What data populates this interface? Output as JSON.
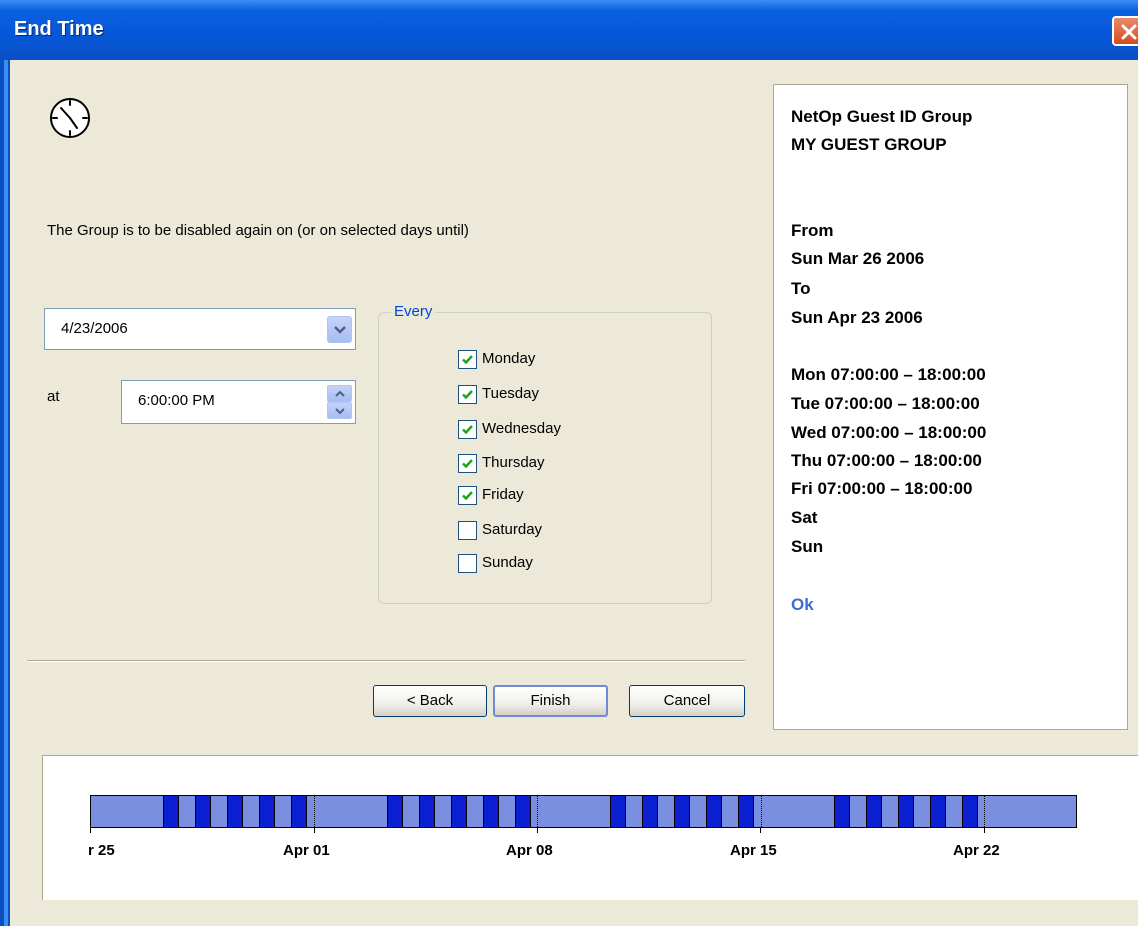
{
  "window": {
    "title": "End Time"
  },
  "description": "The Group is to be disabled again on (or on selected days until)",
  "end_date": {
    "value": "4/23/2006"
  },
  "end_time": {
    "label": "at",
    "value": "6:00:00 PM"
  },
  "every_group": {
    "legend": "Every",
    "days": [
      {
        "label": "Monday",
        "checked": true
      },
      {
        "label": "Tuesday",
        "checked": true
      },
      {
        "label": "Wednesday",
        "checked": true
      },
      {
        "label": "Thursday",
        "checked": true
      },
      {
        "label": "Friday",
        "checked": true
      },
      {
        "label": "Saturday",
        "checked": false
      },
      {
        "label": "Sunday",
        "checked": false
      }
    ]
  },
  "buttons": {
    "back": "< Back",
    "finish": "Finish",
    "cancel": "Cancel"
  },
  "summary": {
    "group_heading": "NetOp Guest ID Group",
    "group_name": "MY GUEST GROUP",
    "from_label": "From",
    "from_date": "Sun Mar 26 2006",
    "to_label": "To",
    "to_date": "Sun Apr 23 2006",
    "schedule": [
      "Mon 07:00:00 – 18:00:00",
      "Tue 07:00:00 – 18:00:00",
      "Wed 07:00:00 – 18:00:00",
      "Thu 07:00:00 – 18:00:00",
      "Fri 07:00:00 – 18:00:00",
      "Sat",
      "Sun"
    ],
    "status": "Ok"
  },
  "timeline": {
    "labels": [
      "r 25",
      "Apr 01",
      "Apr 08",
      "Apr 15",
      "Apr 22"
    ],
    "colors": {
      "inactive": "#7a8fe0",
      "active": "#0a1fd0"
    }
  }
}
